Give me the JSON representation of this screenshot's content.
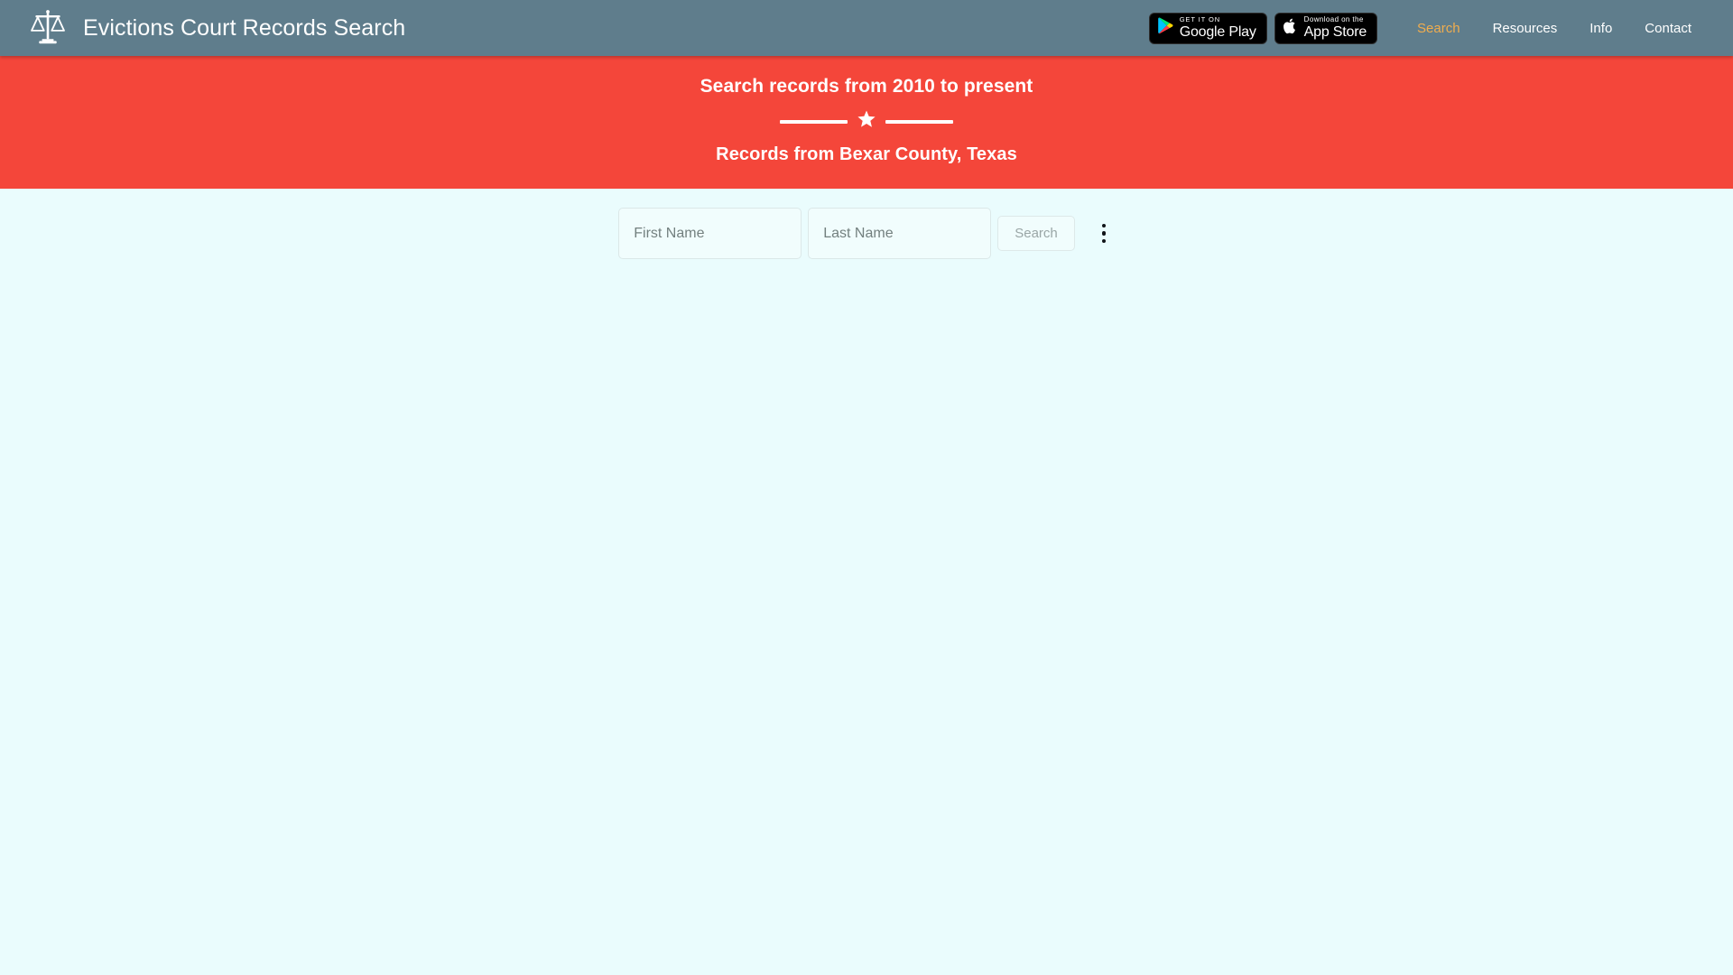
{
  "header": {
    "logo_icon": "scales-of-justice-icon",
    "title": "Evictions Court Records Search",
    "badges": [
      {
        "name": "google-play-badge",
        "icon": "google-play-icon",
        "small_text": "GET IT ON",
        "big_text": "Google Play"
      },
      {
        "name": "app-store-badge",
        "icon": "apple-icon",
        "small_text": "Download on the",
        "big_text": "App Store"
      }
    ],
    "nav": [
      {
        "label": "Search",
        "active": true
      },
      {
        "label": "Resources",
        "active": false
      },
      {
        "label": "Info",
        "active": false
      },
      {
        "label": "Contact",
        "active": false
      }
    ]
  },
  "banner": {
    "line1": "Search records from 2010 to present",
    "divider_icon": "star-icon",
    "line2": "Records from Bexar County, Texas"
  },
  "search": {
    "first_name_value": "",
    "first_name_placeholder": "First Name",
    "last_name_value": "",
    "last_name_placeholder": "Last Name",
    "search_label": "Search",
    "menu_icon": "kebab-menu-icon"
  },
  "colors": {
    "header_bg": "#5f7d8c",
    "banner_bg": "#f4463a",
    "page_bg": "#eafcfd",
    "nav_active": "#f0ad4e",
    "badge_bg": "#000000"
  }
}
